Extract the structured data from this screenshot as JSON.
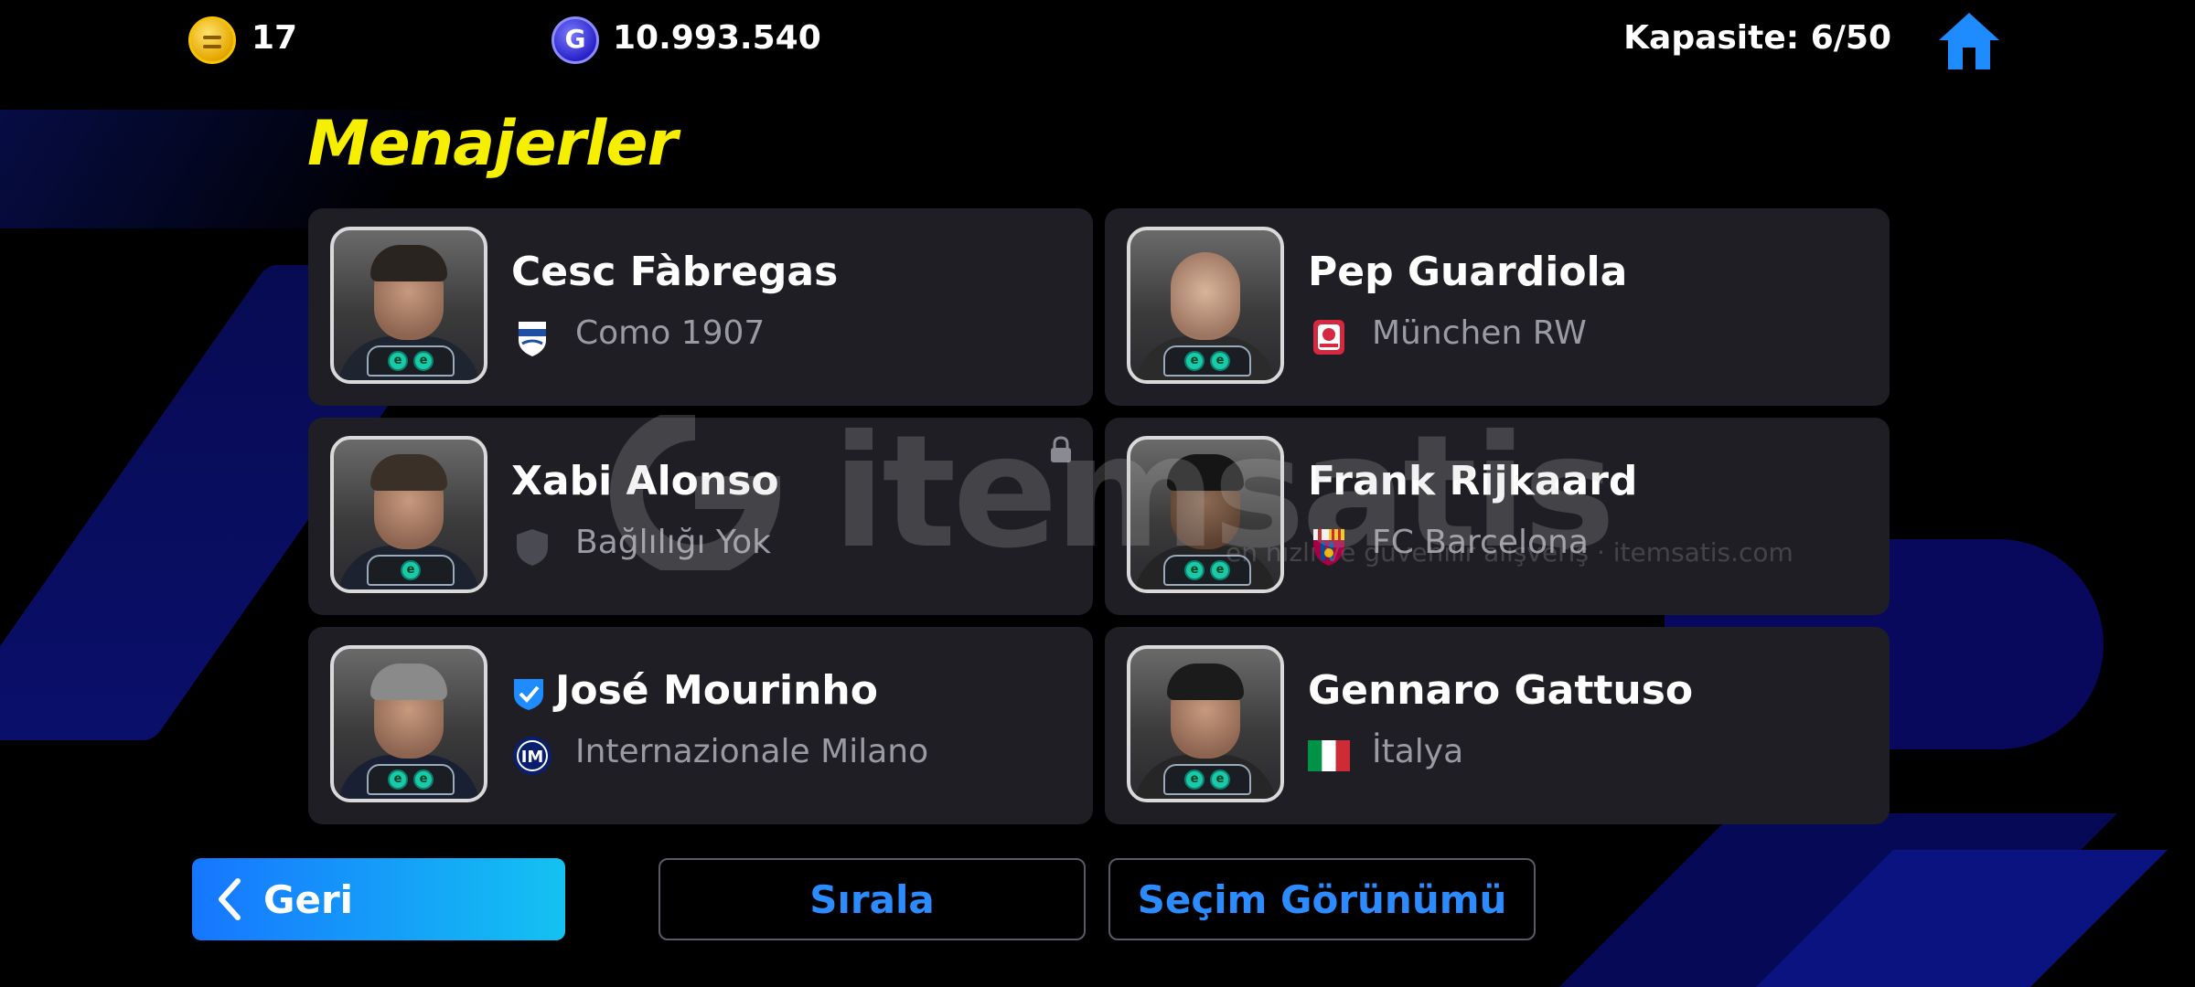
{
  "header": {
    "coins_value": "17",
    "gp_icon_letter": "G",
    "gp_value": "10.993.540",
    "capacity_label": "Kapasite: 6/50"
  },
  "page_title": "Menajerler",
  "managers": [
    {
      "name": "Cesc Fàbregas",
      "club": "Como 1907",
      "club_icon": "como-crest-icon",
      "badges": [
        "e",
        "e"
      ],
      "verified": false,
      "locked": false
    },
    {
      "name": "Pep Guardiola",
      "club": "München RW",
      "club_icon": "munchen-rw-crest-icon",
      "badges": [
        "e",
        "e"
      ],
      "verified": false,
      "locked": false
    },
    {
      "name": "Xabi Alonso",
      "club": "Bağlılığı Yok",
      "club_icon": "no-affiliation-shield-icon",
      "badges": [
        "e"
      ],
      "verified": false,
      "locked": true
    },
    {
      "name": "Frank Rijkaard",
      "club": "FC Barcelona",
      "club_icon": "fc-barcelona-crest-icon",
      "badges": [
        "e",
        "e"
      ],
      "verified": false,
      "locked": false
    },
    {
      "name": "José Mourinho",
      "club": "Internazionale Milano",
      "club_icon": "inter-milan-crest-icon",
      "badges": [
        "e",
        "e"
      ],
      "verified": true,
      "locked": false
    },
    {
      "name": "Gennaro Gattuso",
      "club": "İtalya",
      "club_icon": "italy-flag-icon",
      "badges": [
        "e",
        "e"
      ],
      "verified": false,
      "locked": false
    }
  ],
  "watermark": {
    "text": "itemsatis",
    "subtext": "en hızlı ve güvenilir alışveriş · itemsatis.com"
  },
  "footer": {
    "back_label": "Geri",
    "sort_label": "Sırala",
    "view_label": "Seçim Görünümü"
  },
  "colors": {
    "title_yellow": "#f6f000",
    "accent_blue": "#2c8cff",
    "card_bg": "#1e1e24"
  }
}
